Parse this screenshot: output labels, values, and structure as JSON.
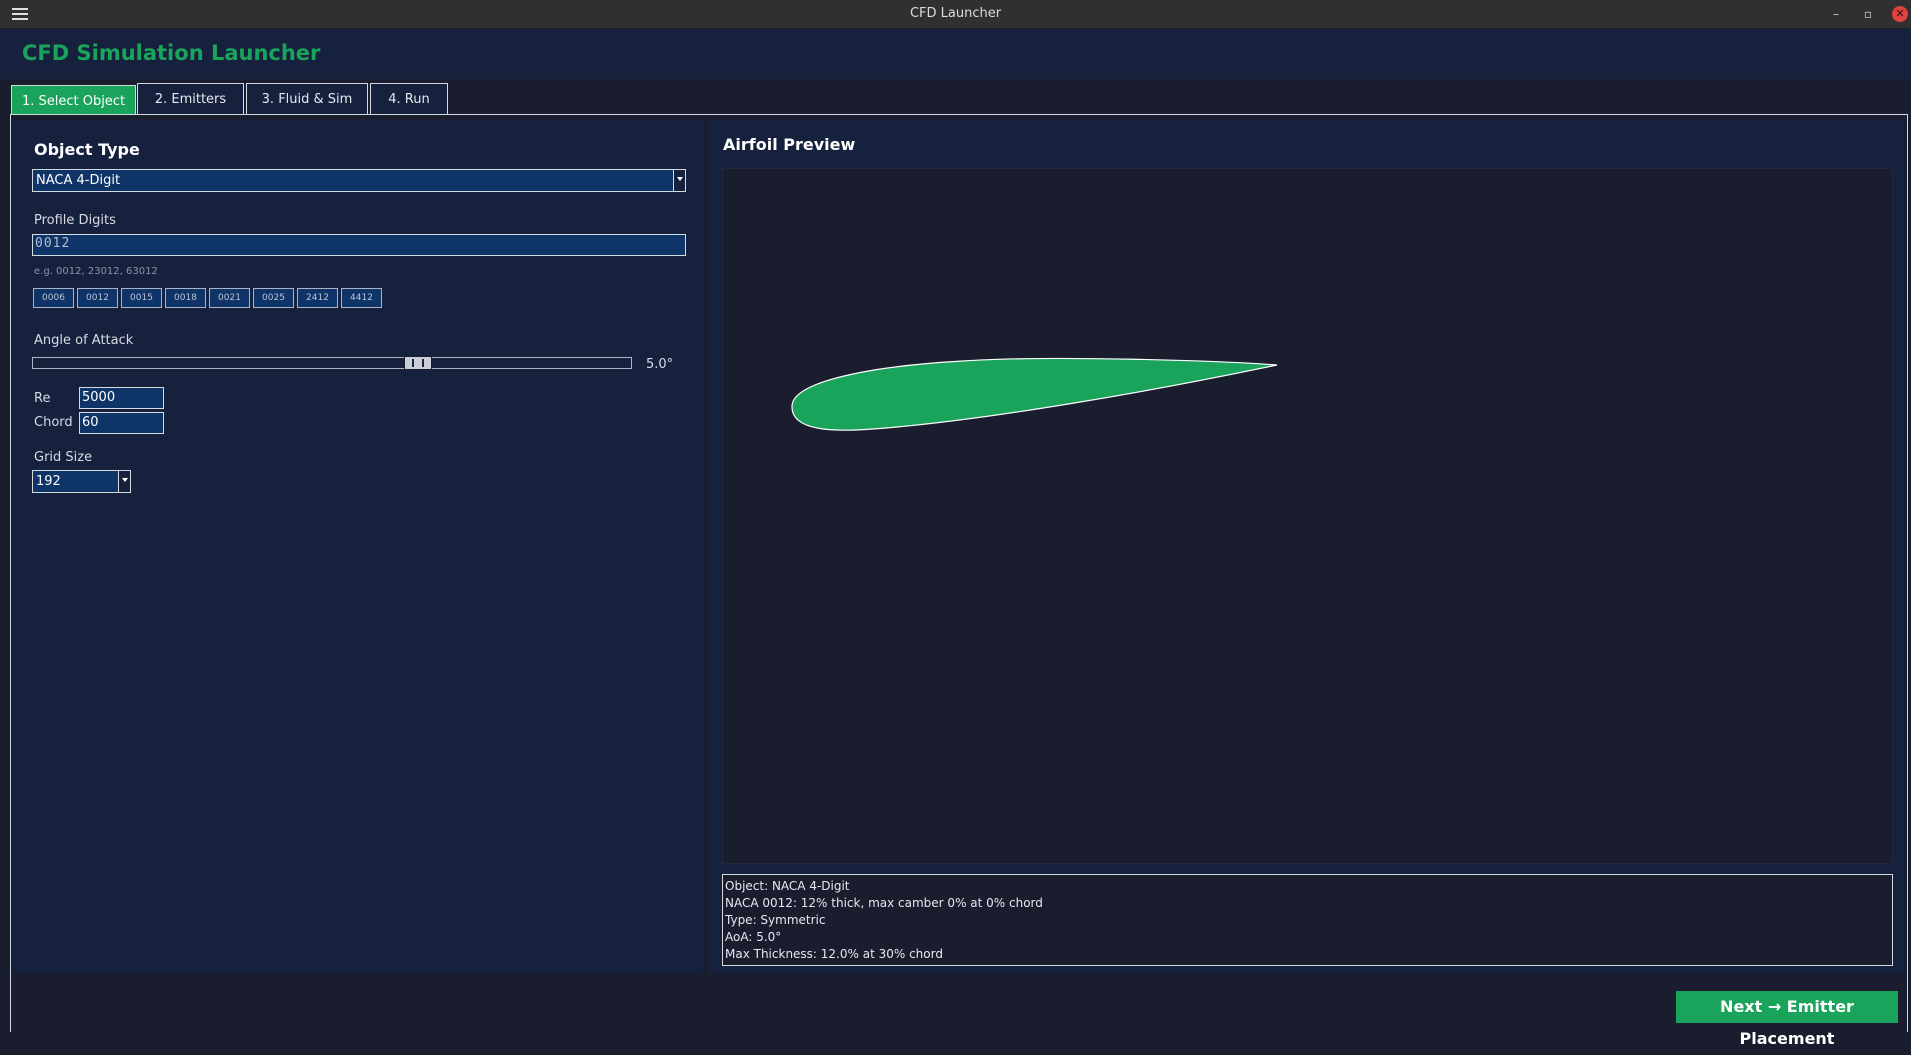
{
  "window": {
    "title": "CFD Launcher",
    "minimize_glyph": "–",
    "restore_glyph": "▫",
    "close_glyph": "✕"
  },
  "header": {
    "app_title": "CFD Simulation Launcher",
    "accent_color": "#1aa35b"
  },
  "tabs": [
    {
      "label": "1. Select Object",
      "active": true
    },
    {
      "label": "2. Emitters",
      "active": false
    },
    {
      "label": "3. Fluid & Sim",
      "active": false
    },
    {
      "label": "4. Run",
      "active": false
    }
  ],
  "object_panel": {
    "heading": "Object Type",
    "object_type_value": "NACA 4-Digit",
    "profile_digits_label": "Profile Digits",
    "profile_digits_value": "0012",
    "hint": "e.g. 0012, 23012, 63012",
    "presets": [
      "0006",
      "0012",
      "0015",
      "0018",
      "0021",
      "0025",
      "2412",
      "4412"
    ],
    "aoa_label": "Angle of Attack",
    "aoa_value_text": "5.0°",
    "aoa_slider_fraction": 0.65,
    "re_label": "Re",
    "re_value": "5000",
    "chord_label": "Chord",
    "chord_value": "60",
    "grid_size_label": "Grid Size",
    "grid_size_value": "192"
  },
  "preview": {
    "title": "Airfoil Preview",
    "airfoil_fill": "#1aa35b",
    "info_lines": [
      "Object: NACA 4-Digit",
      "NACA 0012: 12% thick, max camber 0% at 0% chord",
      "Type: Symmetric",
      "AoA: 5.0°",
      "Max Thickness: 12.0% at 30% chord"
    ]
  },
  "footer": {
    "next_label": "Next → Emitter Placement"
  }
}
